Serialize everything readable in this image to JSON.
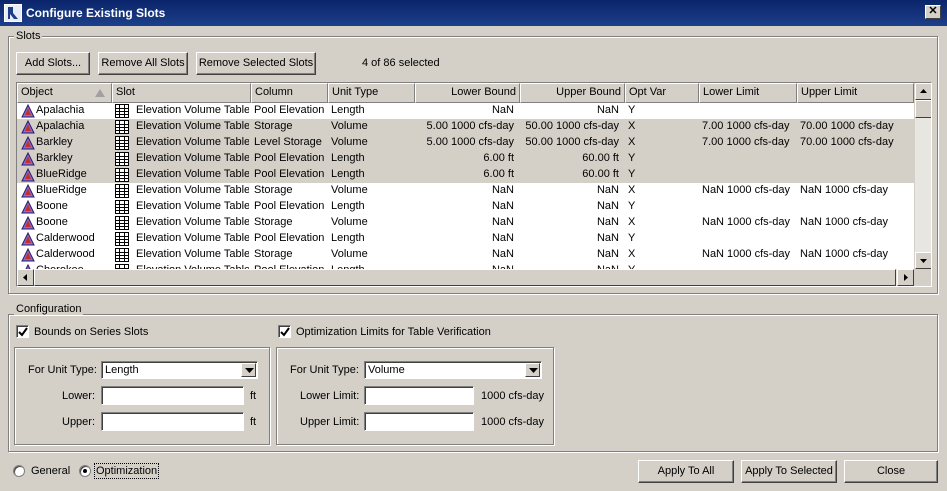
{
  "window": {
    "title": "Configure Existing Slots",
    "close_glyph": "✕"
  },
  "slots_group": {
    "legend": "Slots",
    "buttons": {
      "add": "Add Slots...",
      "remove_all": "Remove All Slots",
      "remove_selected": "Remove Selected Slots"
    },
    "selection_status": "4 of 86 selected"
  },
  "table": {
    "columns": [
      "Object",
      "Slot",
      "Column",
      "Unit Type",
      "Lower Bound",
      "Upper Bound",
      "Opt Var",
      "Lower Limit",
      "Upper Limit"
    ],
    "sort_column": "Object",
    "object_icon": "reservoir-triangle-icon",
    "slot_icon": "table-slot-icon",
    "rows": [
      {
        "object": "Apalachia",
        "slot": "Elevation Volume Table",
        "column": "Pool Elevation",
        "unit_type": "Length",
        "lower_bound": "NaN",
        "upper_bound": "NaN",
        "opt_var": "Y",
        "lower_limit": "",
        "upper_limit": "",
        "selected": false
      },
      {
        "object": "Apalachia",
        "slot": "Elevation Volume Table",
        "column": "Storage",
        "unit_type": "Volume",
        "lower_bound": "5.00 1000 cfs-day",
        "upper_bound": "50.00 1000 cfs-day",
        "opt_var": "X",
        "lower_limit": "7.00 1000 cfs-day",
        "upper_limit": "70.00 1000 cfs-day",
        "selected": true
      },
      {
        "object": "Barkley",
        "slot": "Elevation Volume Table",
        "column": "Level Storage",
        "unit_type": "Volume",
        "lower_bound": "5.00 1000 cfs-day",
        "upper_bound": "50.00 1000 cfs-day",
        "opt_var": "X",
        "lower_limit": "7.00 1000 cfs-day",
        "upper_limit": "70.00 1000 cfs-day",
        "selected": true
      },
      {
        "object": "Barkley",
        "slot": "Elevation Volume Table",
        "column": "Pool Elevation",
        "unit_type": "Length",
        "lower_bound": "6.00 ft",
        "upper_bound": "60.00 ft",
        "opt_var": "Y",
        "lower_limit": "",
        "upper_limit": "",
        "selected": true
      },
      {
        "object": "BlueRidge",
        "slot": "Elevation Volume Table",
        "column": "Pool Elevation",
        "unit_type": "Length",
        "lower_bound": "6.00 ft",
        "upper_bound": "60.00 ft",
        "opt_var": "Y",
        "lower_limit": "",
        "upper_limit": "",
        "selected": true
      },
      {
        "object": "BlueRidge",
        "slot": "Elevation Volume Table",
        "column": "Storage",
        "unit_type": "Volume",
        "lower_bound": "NaN",
        "upper_bound": "NaN",
        "opt_var": "X",
        "lower_limit": "NaN 1000 cfs-day",
        "upper_limit": "NaN 1000 cfs-day",
        "selected": false
      },
      {
        "object": "Boone",
        "slot": "Elevation Volume Table",
        "column": "Pool Elevation",
        "unit_type": "Length",
        "lower_bound": "NaN",
        "upper_bound": "NaN",
        "opt_var": "Y",
        "lower_limit": "",
        "upper_limit": "",
        "selected": false
      },
      {
        "object": "Boone",
        "slot": "Elevation Volume Table",
        "column": "Storage",
        "unit_type": "Volume",
        "lower_bound": "NaN",
        "upper_bound": "NaN",
        "opt_var": "X",
        "lower_limit": "NaN 1000 cfs-day",
        "upper_limit": "NaN 1000 cfs-day",
        "selected": false
      },
      {
        "object": "Calderwood",
        "slot": "Elevation Volume Table",
        "column": "Pool Elevation",
        "unit_type": "Length",
        "lower_bound": "NaN",
        "upper_bound": "NaN",
        "opt_var": "Y",
        "lower_limit": "",
        "upper_limit": "",
        "selected": false
      },
      {
        "object": "Calderwood",
        "slot": "Elevation Volume Table",
        "column": "Storage",
        "unit_type": "Volume",
        "lower_bound": "NaN",
        "upper_bound": "NaN",
        "opt_var": "X",
        "lower_limit": "NaN 1000 cfs-day",
        "upper_limit": "NaN 1000 cfs-day",
        "selected": false
      },
      {
        "object": "Cherokee",
        "slot": "Elevation Volume Table",
        "column": "Pool Elevation",
        "unit_type": "Length",
        "lower_bound": "NaN",
        "upper_bound": "NaN",
        "opt_var": "Y",
        "lower_limit": "",
        "upper_limit": "",
        "selected": false
      }
    ]
  },
  "configuration": {
    "legend": "Configuration",
    "bounds": {
      "checkbox_label": "Bounds on Series Slots",
      "checked": true,
      "unit_type_label": "For Unit Type:",
      "unit_type_value": "Length",
      "lower_label": "Lower:",
      "lower_value": "",
      "lower_unit": "ft",
      "upper_label": "Upper:",
      "upper_value": "",
      "upper_unit": "ft"
    },
    "limits": {
      "checkbox_label": "Optimization Limits for Table Verification",
      "checked": true,
      "unit_type_label": "For Unit Type:",
      "unit_type_value": "Volume",
      "lower_label": "Lower Limit:",
      "lower_value": "",
      "lower_unit": "1000 cfs-day",
      "upper_label": "Upper Limit:",
      "upper_value": "",
      "upper_unit": "1000 cfs-day"
    }
  },
  "mode": {
    "options": [
      "General",
      "Optimization"
    ],
    "selected": "Optimization"
  },
  "footer": {
    "apply_all": "Apply To All",
    "apply_selected": "Apply To Selected",
    "close": "Close"
  }
}
